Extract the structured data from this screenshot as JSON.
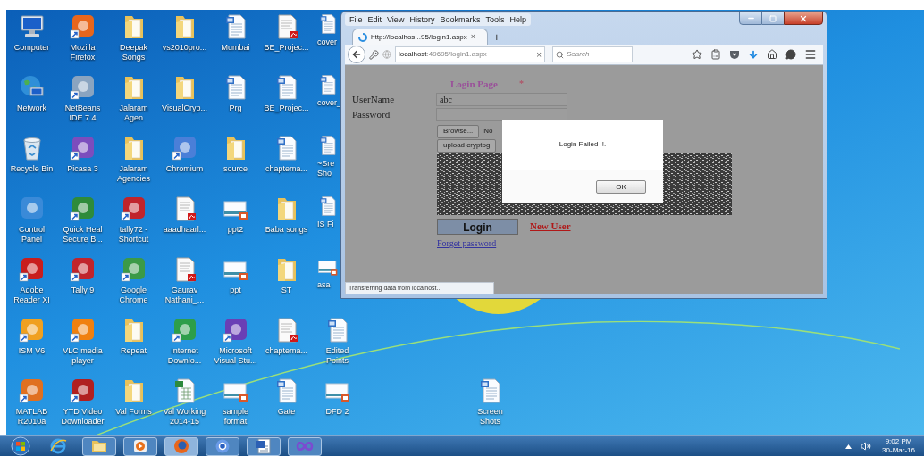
{
  "desktop": {
    "icons": [
      {
        "label": "Computer",
        "kind": "computer"
      },
      {
        "label": "Network",
        "kind": "network"
      },
      {
        "label": "Recycle Bin",
        "kind": "recycle"
      },
      {
        "label": "Control\nPanel",
        "kind": "app",
        "color": "#3a8ad8",
        "shortcut": false
      },
      {
        "label": "Adobe\nReader XI",
        "kind": "app",
        "color": "#c81e1e",
        "shortcut": true
      },
      {
        "label": "ISM V6",
        "kind": "app",
        "color": "#f0a020",
        "shortcut": true
      },
      {
        "label": "MATLAB\nR2010a",
        "kind": "app",
        "color": "#e07020",
        "shortcut": true
      },
      {
        "label": "Mozilla\nFirefox",
        "kind": "app",
        "color": "#e8661c",
        "shortcut": true
      },
      {
        "label": "NetBeans\nIDE 7.4",
        "kind": "app",
        "color": "#8aa4c0",
        "shortcut": true
      },
      {
        "label": "Picasa 3",
        "kind": "app",
        "color": "#7c4dbd",
        "shortcut": true
      },
      {
        "label": "Quick Heal\nSecure B...",
        "kind": "app",
        "color": "#2e8b3a",
        "shortcut": true
      },
      {
        "label": "Tally 9",
        "kind": "app",
        "color": "#c0242c",
        "shortcut": true
      },
      {
        "label": "VLC media\nplayer",
        "kind": "app",
        "color": "#f08010",
        "shortcut": true
      },
      {
        "label": "YTD Video\nDownloader",
        "kind": "app",
        "color": "#b02020",
        "shortcut": true
      },
      {
        "label": "Deepak\nSongs",
        "kind": "folder"
      },
      {
        "label": "Jalaram\nAgen",
        "kind": "folder"
      },
      {
        "label": "Jalaram\nAgencies",
        "kind": "folder"
      },
      {
        "label": "tally72 -\nShortcut",
        "kind": "app",
        "color": "#c0242c",
        "shortcut": true
      },
      {
        "label": "Google\nChrome",
        "kind": "app",
        "color": "#3b9a47",
        "shortcut": true
      },
      {
        "label": "Repeat",
        "kind": "folder"
      },
      {
        "label": "Val Forms",
        "kind": "folder"
      },
      {
        "label": "vs2010pro...",
        "kind": "folder"
      },
      {
        "label": "VisualCryp...",
        "kind": "folder"
      },
      {
        "label": "Chromium",
        "kind": "app",
        "color": "#4a7fd8",
        "shortcut": true
      },
      {
        "label": "aaadhaarl...",
        "kind": "pdf"
      },
      {
        "label": "Gaurav\nNathani_...",
        "kind": "pdf"
      },
      {
        "label": "Internet\nDownlo...",
        "kind": "app",
        "color": "#2d9e4a",
        "shortcut": true
      },
      {
        "label": "Val Working\n2014-15",
        "kind": "sheet"
      },
      {
        "label": "Mumbai",
        "kind": "document"
      },
      {
        "label": "Prg",
        "kind": "document"
      },
      {
        "label": "source",
        "kind": "folder"
      },
      {
        "label": "ppt2",
        "kind": "slide"
      },
      {
        "label": "ppt",
        "kind": "slide"
      },
      {
        "label": "Microsoft\nVisual Stu...",
        "kind": "app",
        "color": "#6a3fb5",
        "shortcut": true
      },
      {
        "label": "sample\nformat",
        "kind": "slide"
      },
      {
        "label": "BE_Projec...",
        "kind": "pdf"
      },
      {
        "label": "BE_Projec...",
        "kind": "document"
      },
      {
        "label": "chaptema...",
        "kind": "document"
      },
      {
        "label": "Baba songs",
        "kind": "folder"
      },
      {
        "label": "ST",
        "kind": "folder"
      },
      {
        "label": "chaptema...",
        "kind": "pdf"
      },
      {
        "label": "Gate",
        "kind": "document"
      },
      {
        "label": "cover",
        "kind": "document"
      },
      {
        "label": "cover_",
        "kind": "document"
      },
      {
        "label": "~Sre\nSho",
        "kind": "document"
      },
      {
        "label": "IS Fi",
        "kind": "document"
      },
      {
        "label": "asa",
        "kind": "slide"
      },
      {
        "label": "Edited\nPoints",
        "kind": "document"
      },
      {
        "label": "DFD 2",
        "kind": "slide"
      }
    ],
    "extra_icons": [
      {
        "label": "Screen\nShots",
        "kind": "document"
      }
    ]
  },
  "browser": {
    "menu": [
      "File",
      "Edit",
      "View",
      "History",
      "Bookmarks",
      "Tools",
      "Help"
    ],
    "tab": {
      "title": "http://localhos...95/login1.aspx",
      "close": "×"
    },
    "new_tab": "+",
    "address": {
      "host": "localhost",
      "rest": ":49695/login1.aspx",
      "clear": "×"
    },
    "search": {
      "placeholder": "Search"
    },
    "page": {
      "title": "Login Page",
      "required_mark": "*",
      "fields": [
        {
          "label": "UserName",
          "value": "abc"
        },
        {
          "label": "Password"
        }
      ],
      "browse_button": "Browse...",
      "file_status": "No",
      "upload_button": "upload cryptog",
      "login_button": "Login",
      "new_user_link": "New User",
      "forgot_link": "Forget password"
    },
    "dialog": {
      "message": "Login Failed !!.",
      "ok": "OK"
    },
    "status": "Transferring data from localhost..."
  },
  "taskbar": {
    "items": [
      {
        "kind": "ie",
        "running": false,
        "selected": false
      },
      {
        "kind": "explorer",
        "running": true,
        "selected": false
      },
      {
        "kind": "media",
        "running": true,
        "selected": false
      },
      {
        "kind": "firefox",
        "running": true,
        "selected": true
      },
      {
        "kind": "chrome",
        "running": true,
        "selected": false
      },
      {
        "kind": "word",
        "running": true,
        "selected": false
      },
      {
        "kind": "vs",
        "running": true,
        "selected": false
      }
    ],
    "time": "9:02 PM",
    "date": "30-Mar-16"
  }
}
